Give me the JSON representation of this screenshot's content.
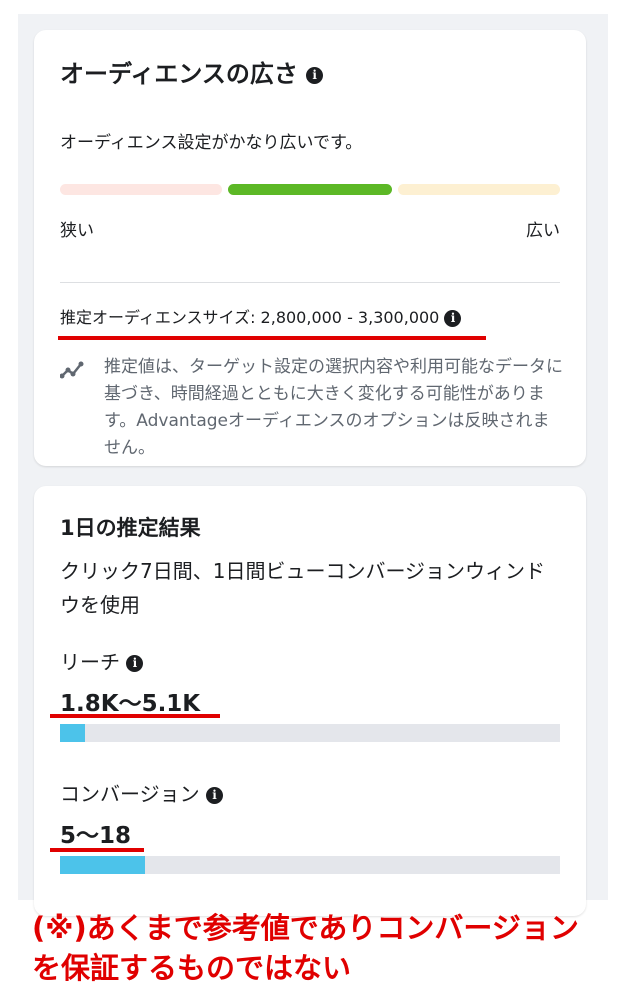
{
  "audience": {
    "title": "オーディエンスの広さ",
    "description": "オーディエンス設定がかなり広いです。",
    "meter_level": "broad",
    "label_narrow": "狭い",
    "label_broad": "広い",
    "size_label": "推定オーディエンスサイズ: 2,800,000 - 3,300,000",
    "note": "推定値は、ターゲット設定の選択内容や利用可能なデータに基づき、時間経過とともに大きく変化する可能性があります。Advantageオーディエンスのオプションは反映されません。"
  },
  "daily": {
    "title": "1日の推定結果",
    "subtitle": "クリック7日間、1日間ビューコンバージョンウィンドウを使用",
    "reach_label": "リーチ",
    "reach_value": "1.8K〜5.1K",
    "reach_fill": 0.05,
    "conversion_label": "コンバージョン",
    "conversion_value": "5〜18",
    "conversion_fill": 0.17
  },
  "disclaimer": "(※)あくまで参考値でありコンバージョンを保証するものではない",
  "colors": {
    "meter_left": "#fde6e2",
    "meter_middle": "#5cb826",
    "meter_right": "#fdf0d2",
    "bar_fill": "#4cc3ea",
    "annotation_red": "#e00000"
  }
}
